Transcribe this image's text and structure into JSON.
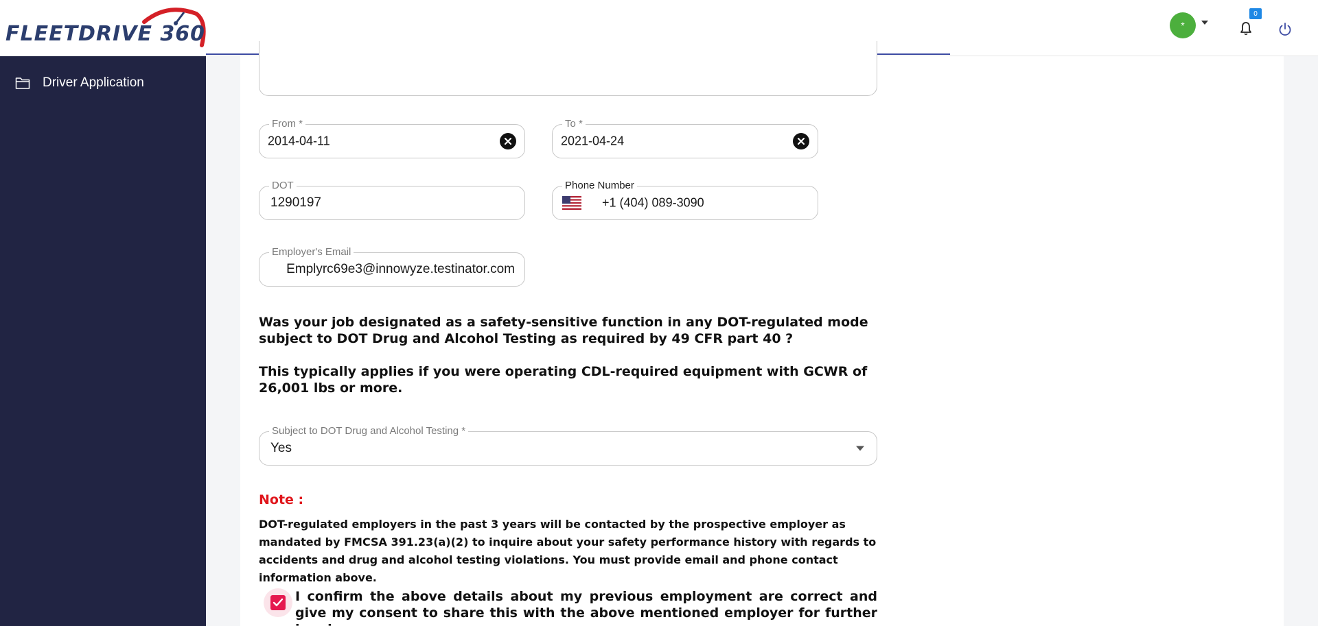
{
  "header": {
    "logo_text": "FLEETDRIVE 360",
    "avatar_glyph": "*",
    "notification_count": "0",
    "accent_color": "#3d4ba3"
  },
  "sidebar": {
    "items": [
      {
        "label": "Driver Application",
        "icon": "folder-icon"
      }
    ]
  },
  "form": {
    "from": {
      "label": "From *",
      "value": "2014-04-11"
    },
    "to": {
      "label": "To *",
      "value": "2021-04-24"
    },
    "dot": {
      "label": "DOT",
      "value": "1290197"
    },
    "phone": {
      "label": "Phone Number",
      "value": "+1 (404) 089-3090",
      "flag": "us-flag-icon"
    },
    "email": {
      "label": "Employer's Email",
      "value": "Emplyrc69e3@innowyze.testinator.com"
    },
    "question_line1": "Was your job designated as a safety-sensitive function in any DOT-regulated mode subject to DOT Drug and Alcohol Testing as required by 49 CFR part 40 ?",
    "question_line2": "This typically applies if you were operating CDL-required equipment with GCWR of 26,001 lbs or more.",
    "drug_testing": {
      "label": "Subject to DOT Drug and Alcohol Testing *",
      "value": "Yes"
    },
    "note_title": "Note :",
    "note_body": "DOT-regulated employers in the past 3 years will be contacted by the prospective employer as mandated by FMCSA 391.23(a)(2) to inquire about your safety performance history with regards to accidents and drug and alcohol testing violations. You must provide email and phone contact information above.",
    "consent_text": "I confirm the above details about my previous employment are correct and give my consent to share this with the above mentioned employer for further inquiry",
    "consent_checked": true
  },
  "colors": {
    "sidebar_bg": "#212443",
    "note_red": "#e0151b",
    "checkbox_pink": "#e5194f",
    "avatar_green": "#4caf3d"
  }
}
